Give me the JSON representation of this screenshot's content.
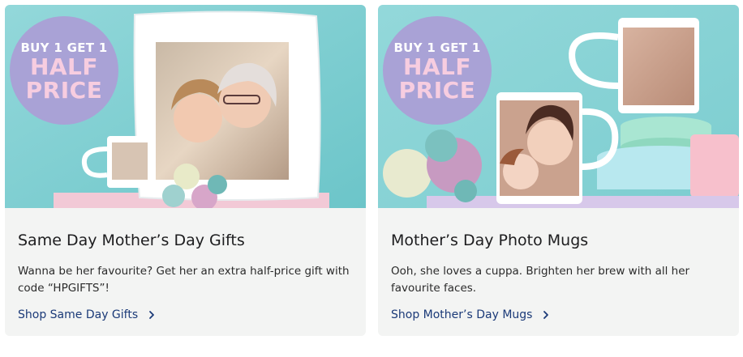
{
  "cards": [
    {
      "badge": {
        "line1": "BUY 1 GET 1",
        "line2": "HALF",
        "line3": "PRICE"
      },
      "title": "Same Day Mother’s Day Gifts",
      "description": "Wanna be her favourite? Get her an extra half-price gift with code “HPGIFTS”!",
      "link_label": "Shop Same Day Gifts",
      "link_icon": "chevron-right-icon"
    },
    {
      "badge": {
        "line1": "BUY 1 GET 1",
        "line2": "HALF",
        "line3": "PRICE"
      },
      "title": "Mother’s Day Photo Mugs",
      "description": "Ooh, she loves a cuppa. Brighten her brew with all her favourite faces.",
      "link_label": "Shop Mother’s Day Mugs",
      "link_icon": "chevron-right-icon"
    }
  ],
  "colors": {
    "hero_background": "#86d3d6",
    "badge_background": "#a9a2d6",
    "badge_accent": "#f7cde0",
    "link": "#1b3a78",
    "card_background": "#f3f4f3"
  }
}
